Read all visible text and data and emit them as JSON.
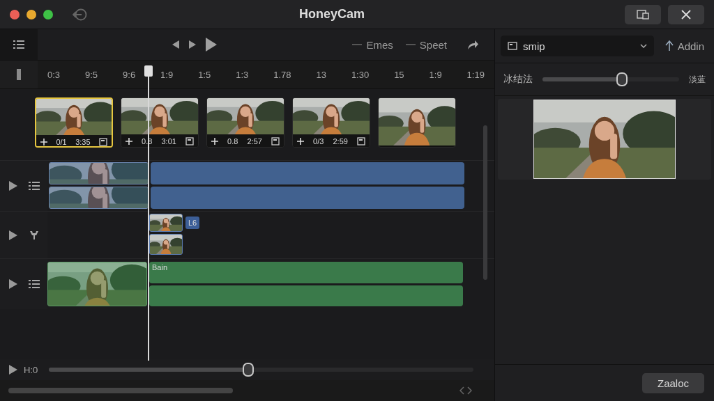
{
  "window": {
    "title": "HoneyCam"
  },
  "toolbar": {
    "labels": [
      "Emes",
      "Speet"
    ]
  },
  "ruler": {
    "ticks": [
      "0:3",
      "9:5",
      "9:6",
      "1:9",
      "1:5",
      "1:3",
      "1.78",
      "13",
      "1:30",
      "15",
      "1:9",
      "1:19"
    ]
  },
  "thumbnails": [
    {
      "selected": true,
      "captions": [
        "0/1",
        "3:35"
      ]
    },
    {
      "selected": false,
      "captions": [
        "0.8",
        "3:01"
      ]
    },
    {
      "selected": false,
      "captions": [
        "0.8",
        "2:57"
      ]
    },
    {
      "selected": false,
      "captions": [
        "0/3",
        "2:59"
      ]
    },
    {
      "selected": false
    }
  ],
  "tracks": [
    {
      "kind": "video",
      "color": "#41618f"
    },
    {
      "kind": "inserts",
      "label": "L6"
    },
    {
      "kind": "audio",
      "color": "#3a7a4a",
      "label": "Bain"
    }
  ],
  "inspector": {
    "dropdown": "smip",
    "add_button": "Addin",
    "slider": {
      "label": "冰结法",
      "reading": "淡蓝",
      "level": 0.58
    }
  },
  "transport": {
    "label": "H:0",
    "level": 0.47
  },
  "footer_button": "Zaaloc"
}
